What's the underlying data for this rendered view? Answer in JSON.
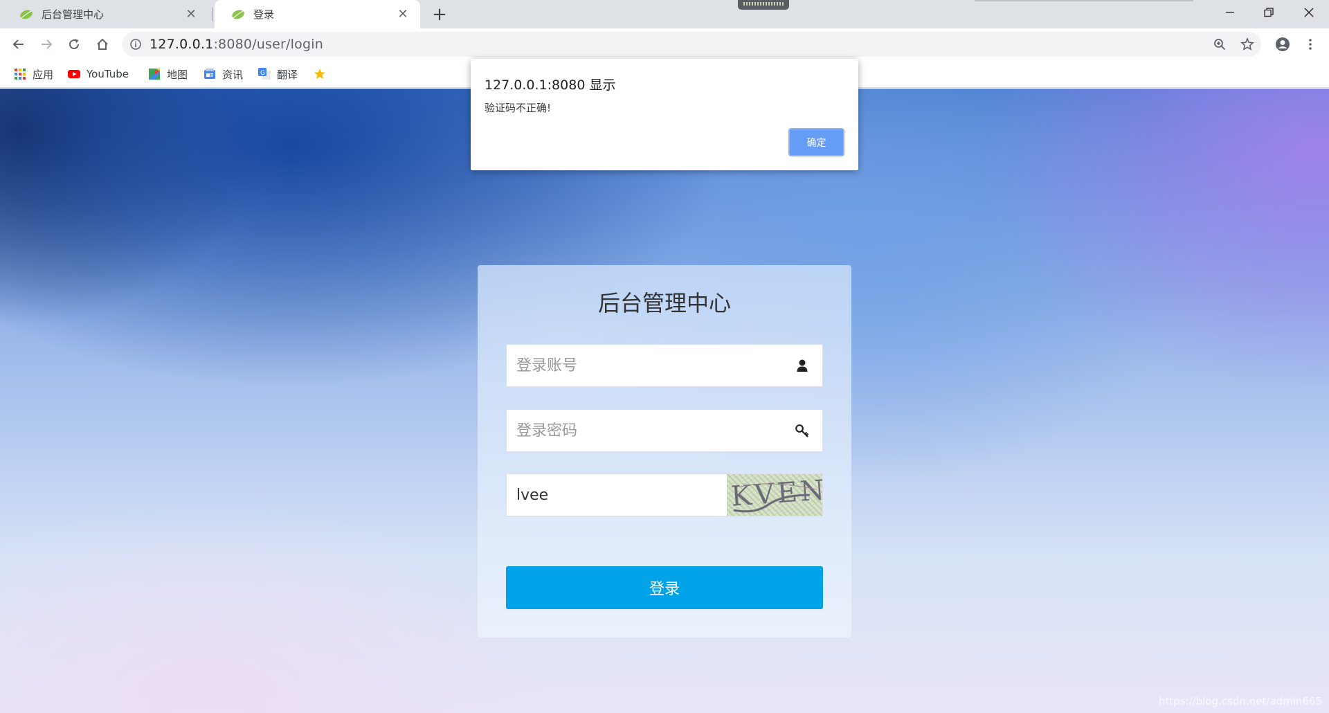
{
  "browser": {
    "tabs": [
      {
        "title": "后台管理中心",
        "active": false
      },
      {
        "title": "登录",
        "active": true
      }
    ],
    "url_host": "127.0.0.1",
    "url_rest": ":8080/user/login",
    "bookmarks": [
      {
        "label": "应用",
        "icon": "apps-icon"
      },
      {
        "label": "YouTube",
        "icon": "youtube-icon"
      },
      {
        "label": "地图",
        "icon": "maps-icon"
      },
      {
        "label": "资讯",
        "icon": "news-icon"
      },
      {
        "label": "翻译",
        "icon": "translate-icon"
      }
    ]
  },
  "alert": {
    "title": "127.0.0.1:8080 显示",
    "message": "验证码不正确!",
    "ok_label": "确定"
  },
  "login": {
    "title": "后台管理中心",
    "username_placeholder": "登录账号",
    "password_placeholder": "登录密码",
    "captcha_value": "lvee",
    "captcha_image_text": "KVEN",
    "submit_label": "登录"
  },
  "watermark": "https://blog.csdn.net/admin665",
  "colors": {
    "primary_button": "#00a2e8",
    "dialog_ok": "#669df6"
  }
}
